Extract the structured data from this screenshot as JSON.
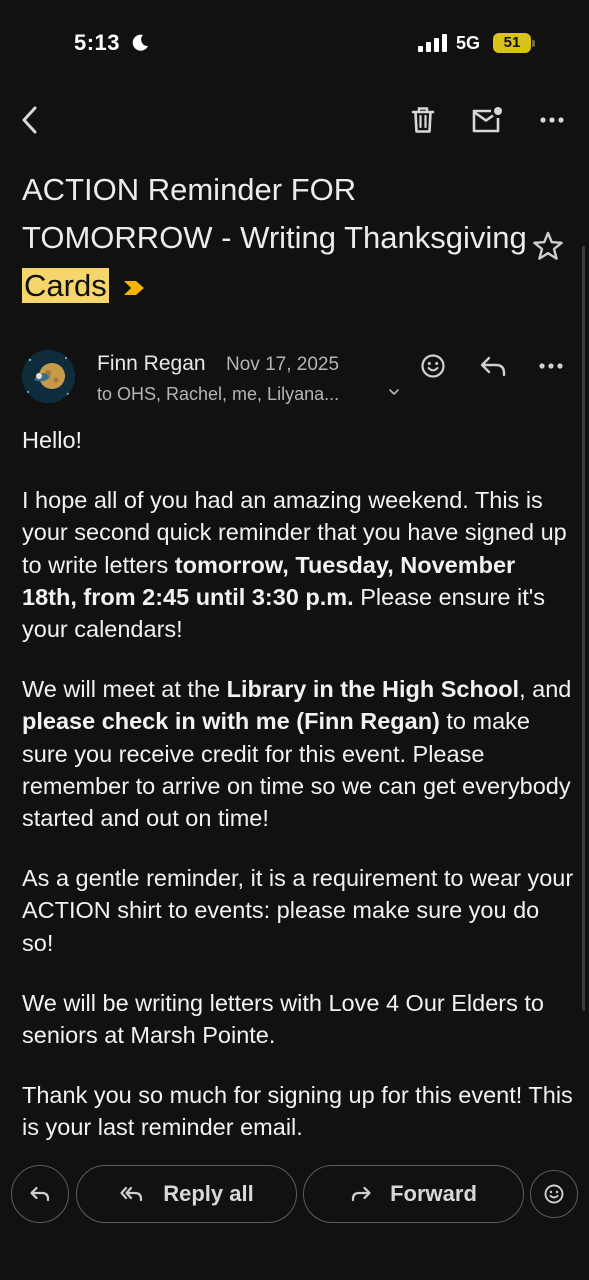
{
  "status_bar": {
    "time": "5:13",
    "network": "5G",
    "battery": "51"
  },
  "toolbar": {
    "icons": [
      "back-arrow-icon",
      "trash-icon",
      "mark-unread-icon",
      "more-icon"
    ]
  },
  "email": {
    "subject_main": "ACTION Reminder FOR TOMORROW - Writing Thanksgiving ",
    "subject_highlight": "Cards",
    "sender_name": "Finn Regan",
    "date": "Nov 17, 2025",
    "recipients": "to OHS, Rachel, me, Lilyana...",
    "body": {
      "greeting": "Hello!",
      "p1_a": "I hope all of you had an amazing weekend. This is your second quick reminder that you have signed up to write letters ",
      "p1_b": "tomorrow, Tuesday, November 18th, from 2:45 until 3:30 p.m.",
      "p1_c": " Please ensure it's your calendars!",
      "p2_a": "We will meet at the ",
      "p2_b": "Library in the High School",
      "p2_c": ", and ",
      "p2_d": "please check in with me (Finn Regan)",
      "p2_e": " to make sure you receive credit for this event. Please remember to arrive on time so we can get everybody started and out on time!",
      "p3": "As a gentle reminder, it is a requirement to wear your ACTION shirt to events: please make sure you do so!",
      "p4": "We will be writing letters with Love 4 Our Elders to seniors at Marsh Pointe.",
      "p5": "Thank you so much for signing up for this event! This is your last reminder email."
    }
  },
  "actions": {
    "reply_all": "Reply all",
    "forward": "Forward"
  },
  "colors": {
    "background": "#111111",
    "highlight": "#f5d66b",
    "important_marker": "#f4b400",
    "battery": "#d9c21a"
  }
}
